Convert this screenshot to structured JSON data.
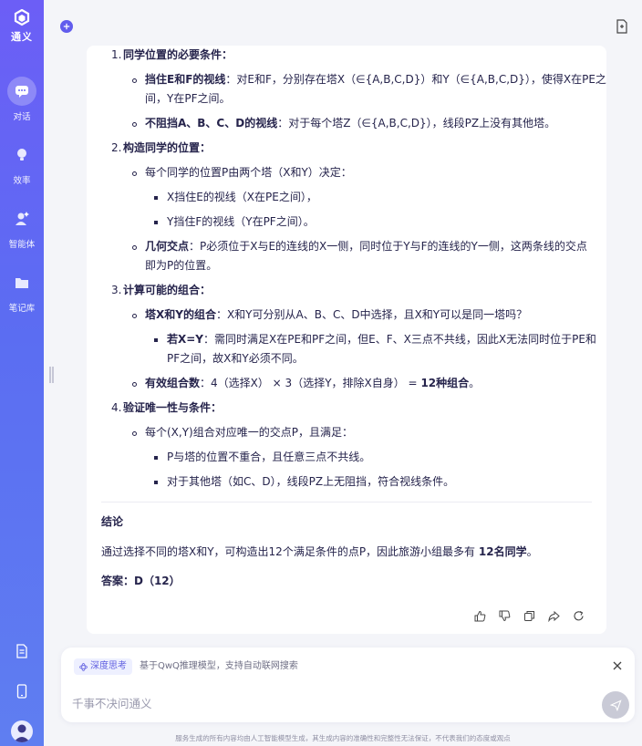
{
  "sidebar": {
    "logo_text": "通义",
    "items": [
      {
        "label": "对话",
        "icon": "chat-icon",
        "active": true
      },
      {
        "label": "效率",
        "icon": "bulb-icon",
        "active": false
      },
      {
        "label": "智能体",
        "icon": "agent-icon",
        "active": false
      },
      {
        "label": "笔记库",
        "icon": "folder-icon",
        "active": false
      }
    ],
    "bottom_icons": [
      "document-icon",
      "phone-icon",
      "avatar-icon"
    ]
  },
  "colors": {
    "accent": "#615ced",
    "sidebar_top": "#6c5ef6",
    "sidebar_bottom": "#5f7ef1",
    "text": "#26244c"
  },
  "answer": {
    "s1": {
      "num": "1.",
      "title": "同学位置的必要条件："
    },
    "s1a": {
      "b": "挡住E和F的视线",
      "t": "：对E和F，分别存在塔X（∈{A,B,C,D}）和Y（∈{A,B,C,D}），使得X在PE之",
      "t2": "间，Y在PF之间。"
    },
    "s1b": {
      "b": "不阻挡A、B、C、D的视线",
      "t": "：对于每个塔Z（∈{A,B,C,D}），线段PZ上没有其他塔。"
    },
    "s2": {
      "num": "2.",
      "title": "构造同学的位置："
    },
    "s2a": {
      "t": "每个同学的位置P由两个塔（X和Y）决定："
    },
    "s2a1": {
      "t": "X挡住E的视线（X在PE之间），"
    },
    "s2a2": {
      "t": "Y挡住F的视线（Y在PF之间）。"
    },
    "s2b": {
      "b": "几何交点",
      "t": "：P必须位于X与E的连线的X一侧，同时位于Y与F的连线的Y一侧，这两条线的交点",
      "t2": "即为P的位置。"
    },
    "s3": {
      "num": "3.",
      "title": "计算可能的组合："
    },
    "s3a": {
      "b": "塔X和Y的组合",
      "t": "：X和Y可分别从A、B、C、D中选择，且X和Y可以是同一塔吗？"
    },
    "s3a1": {
      "b": "若X=Y",
      "t": "：需同时满足X在PE和PF之间，但E、F、X三点不共线，因此X无法同时位于PE和",
      "t2": "PF之间，故X和Y必须不同。"
    },
    "s3b": {
      "b": "有效组合数",
      "t": "：4（选择X） × 3（选择Y，排除X自身） = ",
      "b2": "12种组合",
      "t3": "。"
    },
    "s4": {
      "num": "4.",
      "title": "验证唯一性与条件："
    },
    "s4a": {
      "t": "每个(X,Y)组合对应唯一的交点P，且满足："
    },
    "s4a1": {
      "t": "P与塔的位置不重合，且任意三点不共线。"
    },
    "s4a2": {
      "t": "对于其他塔（如C、D），线段PZ上无阻挡，符合视线条件。"
    },
    "conclusion_title": "结论",
    "conclusion_text": "通过选择不同的塔X和Y，可构造出12个满足条件的点P，因此旅游小组最多有 ",
    "conclusion_bold": "12名同学",
    "conclusion_end": "。",
    "answer_label": "答案：D（12）"
  },
  "actions": [
    "thumbs-up-icon",
    "thumbs-down-icon",
    "copy-icon",
    "share-icon",
    "regenerate-icon"
  ],
  "input": {
    "deep_think_label": "深度思考",
    "deep_think_desc": "基于QwQ推理模型，支持自动联网搜索",
    "placeholder": "千事不决问通义"
  },
  "footer": "服务生成的所有内容均由人工智能模型生成，其生成内容的准确性和完整性无法保证，不代表我们的态度或观点"
}
